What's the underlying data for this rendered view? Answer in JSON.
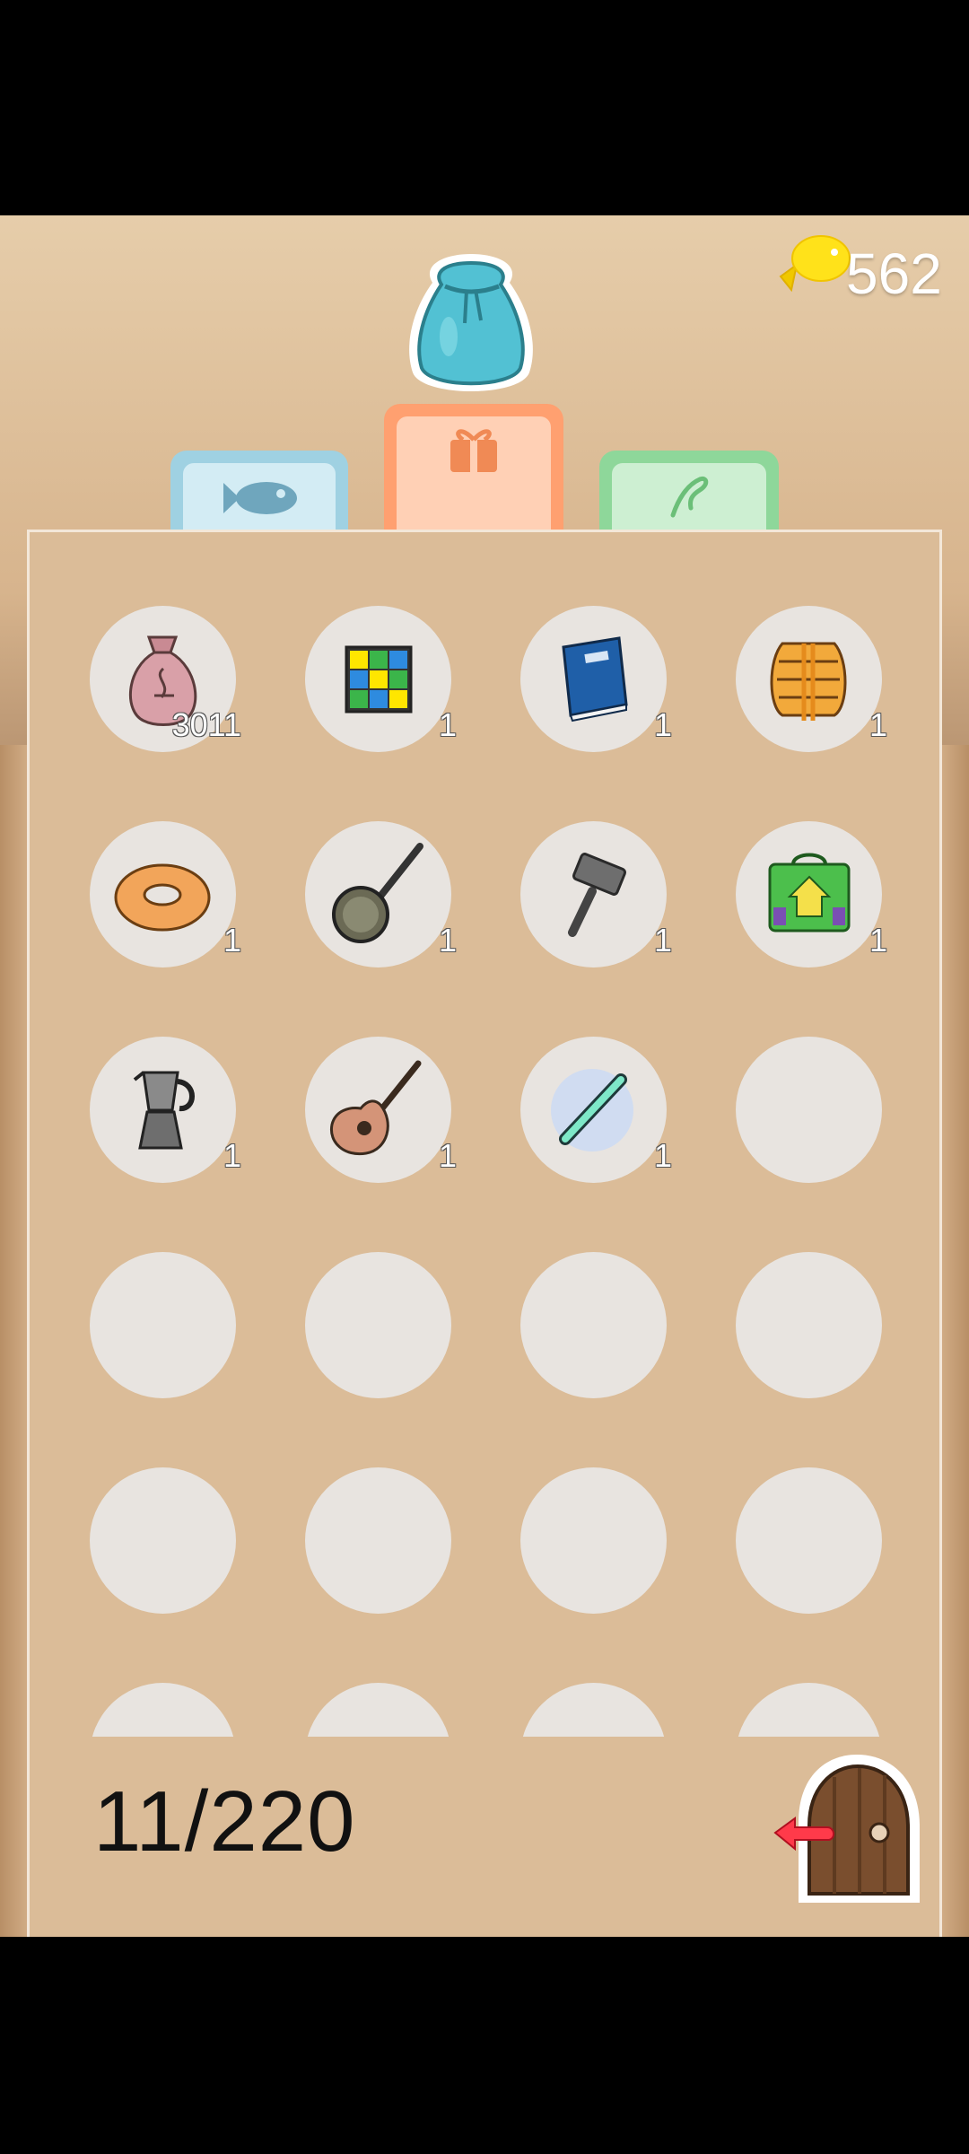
{
  "header": {
    "currency_icon": "fish-coin-icon",
    "currency_amount": "562",
    "bag_icon": "item-bag-icon"
  },
  "tabs": [
    {
      "name": "fish",
      "icon": "fish-icon",
      "color": "#9fd1e2",
      "active": false
    },
    {
      "name": "items",
      "icon": "gift-box-icon",
      "color": "#ffa070",
      "active": true
    },
    {
      "name": "decor",
      "icon": "sprout-icon",
      "color": "#8ed79a",
      "active": false
    }
  ],
  "inventory": {
    "items": [
      {
        "icon": "money-bag-icon",
        "quantity": "3011"
      },
      {
        "icon": "rubiks-cube-icon",
        "quantity": "1"
      },
      {
        "icon": "blue-book-icon",
        "quantity": "1"
      },
      {
        "icon": "life-jacket-icon",
        "quantity": "1"
      },
      {
        "icon": "donut-ring-icon",
        "quantity": "1"
      },
      {
        "icon": "banjo-icon",
        "quantity": "1"
      },
      {
        "icon": "hammer-icon",
        "quantity": "1"
      },
      {
        "icon": "green-box-icon",
        "quantity": "1"
      },
      {
        "icon": "moka-pot-icon",
        "quantity": "1"
      },
      {
        "icon": "guitar-icon",
        "quantity": "1"
      },
      {
        "icon": "glow-stick-icon",
        "quantity": "1"
      }
    ],
    "capacity_text": "11/220"
  },
  "exit": {
    "icon": "exit-door-icon"
  }
}
